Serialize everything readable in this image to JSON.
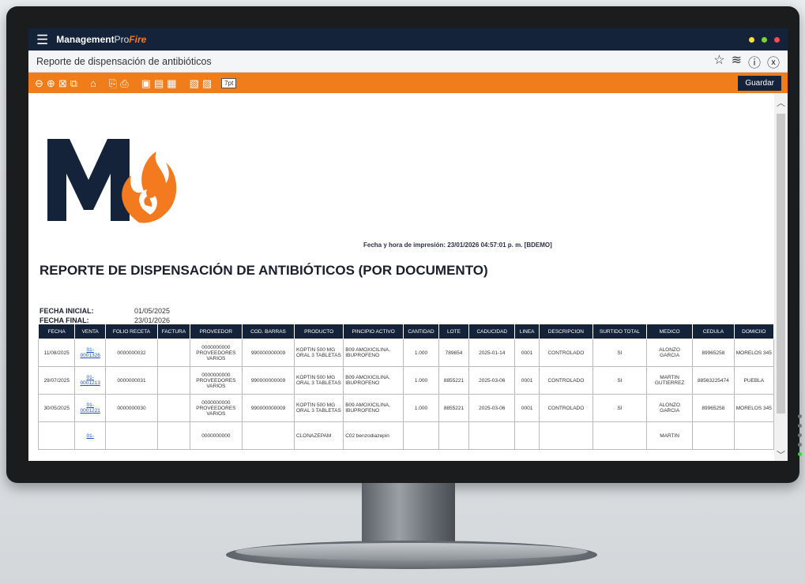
{
  "app": {
    "brand_main": "Management",
    "brand_pro": "Pro",
    "brand_fire": "Fire"
  },
  "colors": {
    "dot1": "#f3e33b",
    "dot2": "#7fd13b",
    "dot3": "#ef4b5c",
    "accent": "#f07d1a",
    "navy": "#14223a"
  },
  "window": {
    "title": "Reporte de dispensación de antibióticos",
    "icons": [
      "star-icon",
      "layers-icon",
      "help-icon",
      "close-icon"
    ]
  },
  "toolbar": {
    "zoom": "7pt",
    "save_label": "Guardar"
  },
  "report": {
    "print_date": "Fecha y hora de impresión: 23/01/2026 04:57:01 p. m. [BDEMO]",
    "title": "REPORTE DE DISPENSACIÓN DE ANTIBIÓTICOS (POR DOCUMENTO)",
    "fecha_inicial_label": "FECHA INICIAL:",
    "fecha_inicial": "01/05/2025",
    "fecha_final_label": "FECHA FINAL:",
    "fecha_final": "23/01/2026",
    "columns": [
      "FECHA",
      "VENTA",
      "FOLIO RECETA",
      "FACTURA",
      "PROVEEDOR",
      "COD. BARRAS",
      "PRODUCTO",
      "PINCIPIO ACTIVO",
      "CANTIDAD",
      "LOTE",
      "CADUCIDAD",
      "LINEA",
      "DESCRIPCION",
      "SURTIDO TOTAL",
      "MEDICO",
      "CEDULA",
      "DOMICIIO"
    ],
    "rows": [
      [
        "11/08/2025",
        "01-0001326",
        "0000000032",
        "",
        "0000000000 PROVEEDORES VARIOS",
        "990000000009",
        "KOPTIN 500 MG ORAL 3 TABLETAS",
        "B09 AMOXICILINA, IBUPROFENO",
        "1.000",
        "789654",
        "2025-01-14",
        "0001",
        "CONTROLADO",
        "SI",
        "ALONZO GARCIA",
        "89965258",
        "MORELOS 345"
      ],
      [
        "29/07/2025",
        "01-0001213",
        "0000000031",
        "",
        "0000000000 PROVEEDORES VARIOS",
        "990000000009",
        "KOPTIN 500 MG ORAL 3 TABLETAS",
        "B09 AMOXICILINA, IBUPROFENO",
        "1.000",
        "8855221",
        "2025-03-06",
        "0001",
        "CONTROLADO",
        "SI",
        "MARTIN GUTIERREZ",
        "88563225474",
        "PUEBLA"
      ],
      [
        "30/05/2025",
        "01-0001221",
        "0000000030",
        "",
        "0000000000 PROVEEDORES VARIOS",
        "990000000009",
        "KOPTIN 500 MG ORAL 3 TABLETAS",
        "B09 AMOXICILINA, IBUPROFENO",
        "1.000",
        "8855221",
        "2025-03-06",
        "0001",
        "CONTROLADO",
        "SI",
        "ALONZO GARCIA",
        "89965258",
        "MORELOS 345"
      ],
      [
        "",
        "01-",
        "",
        "",
        "0000000000",
        "",
        "CLONAZEPAM",
        "C02 benzodiazepin",
        "",
        "",
        "",
        "",
        "",
        "",
        "MARTIN",
        "",
        ""
      ]
    ]
  }
}
